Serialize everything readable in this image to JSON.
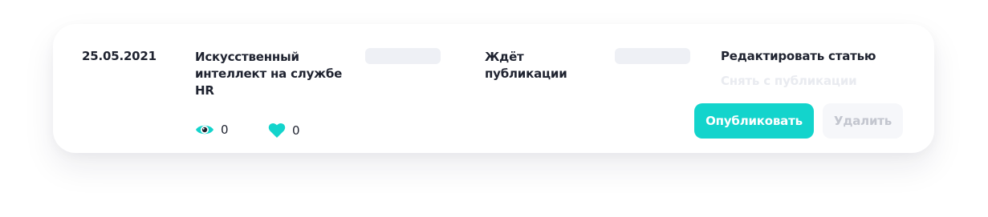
{
  "article": {
    "date": "25.05.2021",
    "title": "Искусственный интеллект на службе HR",
    "status": "Ждёт публикации",
    "views": "0",
    "likes": "0"
  },
  "actions": {
    "edit_label": "Редактировать статью",
    "unpublish_label": "Снять с публикации",
    "publish_label": "Опубликовать",
    "delete_label": "Удалить"
  },
  "icons": {
    "views": "eye-icon",
    "likes": "heart-icon"
  },
  "colors": {
    "accent": "#13d4cc",
    "text": "#1f2330",
    "disabled_text": "#e9ebf0",
    "placeholder": "#eef0f5",
    "delete_bg": "#f6f7fa"
  }
}
